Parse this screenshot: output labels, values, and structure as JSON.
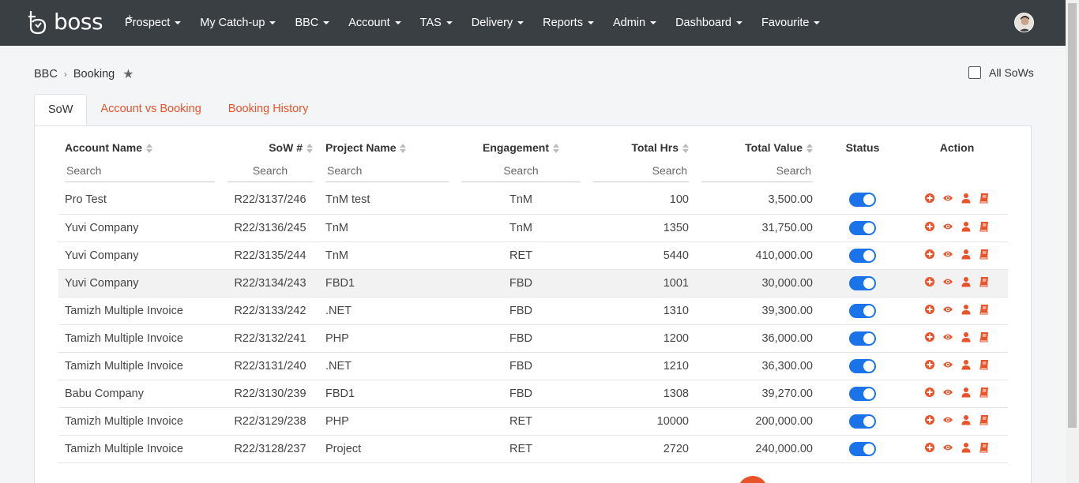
{
  "app": {
    "logo_text": "boss",
    "logo_plus": "+"
  },
  "nav": {
    "items": [
      {
        "label": "Prospect"
      },
      {
        "label": "My Catch-up"
      },
      {
        "label": "BBC"
      },
      {
        "label": "Account"
      },
      {
        "label": "TAS"
      },
      {
        "label": "Delivery"
      },
      {
        "label": "Reports"
      },
      {
        "label": "Admin"
      },
      {
        "label": "Dashboard"
      },
      {
        "label": "Favourite"
      }
    ]
  },
  "breadcrumb": {
    "parent": "BBC",
    "separator": "›",
    "current": "Booking"
  },
  "all_sows": {
    "label": "All SoWs",
    "checked": false
  },
  "tabs": [
    {
      "label": "SoW",
      "active": true
    },
    {
      "label": "Account vs Booking",
      "active": false
    },
    {
      "label": "Booking History",
      "active": false
    }
  ],
  "table": {
    "columns": [
      {
        "label": "Account Name",
        "search_placeholder": "Search"
      },
      {
        "label": "SoW #",
        "search_placeholder": "Search"
      },
      {
        "label": "Project Name",
        "search_placeholder": "Search"
      },
      {
        "label": "Engagement",
        "search_placeholder": "Search"
      },
      {
        "label": "Total Hrs",
        "search_placeholder": "Search"
      },
      {
        "label": "Total Value",
        "search_placeholder": "Search"
      },
      {
        "label": "Status"
      },
      {
        "label": "Action"
      }
    ],
    "rows": [
      {
        "account": "Pro Test",
        "sow": "R22/3137/246",
        "project": "TnM test",
        "engagement": "TnM",
        "hrs": "100",
        "value": "3,500.00",
        "status": true
      },
      {
        "account": "Yuvi Company",
        "sow": "R22/3136/245",
        "project": "TnM",
        "engagement": "TnM",
        "hrs": "1350",
        "value": "31,750.00",
        "status": true
      },
      {
        "account": "Yuvi Company",
        "sow": "R22/3135/244",
        "project": "TnM",
        "engagement": "RET",
        "hrs": "5440",
        "value": "410,000.00",
        "status": true
      },
      {
        "account": "Yuvi Company",
        "sow": "R22/3134/243",
        "project": "FBD1",
        "engagement": "FBD",
        "hrs": "1001",
        "value": "30,000.00",
        "status": true
      },
      {
        "account": "Tamizh Multiple Invoice",
        "sow": "R22/3133/242",
        "project": ".NET",
        "engagement": "FBD",
        "hrs": "1310",
        "value": "39,300.00",
        "status": true
      },
      {
        "account": "Tamizh Multiple Invoice",
        "sow": "R22/3132/241",
        "project": "PHP",
        "engagement": "FBD",
        "hrs": "1200",
        "value": "36,000.00",
        "status": true
      },
      {
        "account": "Tamizh Multiple Invoice",
        "sow": "R22/3131/240",
        "project": ".NET",
        "engagement": "FBD",
        "hrs": "1210",
        "value": "36,300.00",
        "status": true
      },
      {
        "account": "Babu Company",
        "sow": "R22/3130/239",
        "project": "FBD1",
        "engagement": "FBD",
        "hrs": "1308",
        "value": "39,270.00",
        "status": true
      },
      {
        "account": "Tamizh Multiple Invoice",
        "sow": "R22/3129/238",
        "project": "PHP",
        "engagement": "RET",
        "hrs": "10000",
        "value": "200,000.00",
        "status": true
      },
      {
        "account": "Tamizh Multiple Invoice",
        "sow": "R22/3128/237",
        "project": "Project",
        "engagement": "RET",
        "hrs": "2720",
        "value": "240,000.00",
        "status": true
      }
    ],
    "action_icons": [
      "add-circle-icon",
      "view-eye-icon",
      "user-icon",
      "book-icon"
    ]
  },
  "colors": {
    "topbar": "#3a3f44",
    "accent": "#e8532a",
    "toggle_on": "#1a73e8"
  }
}
